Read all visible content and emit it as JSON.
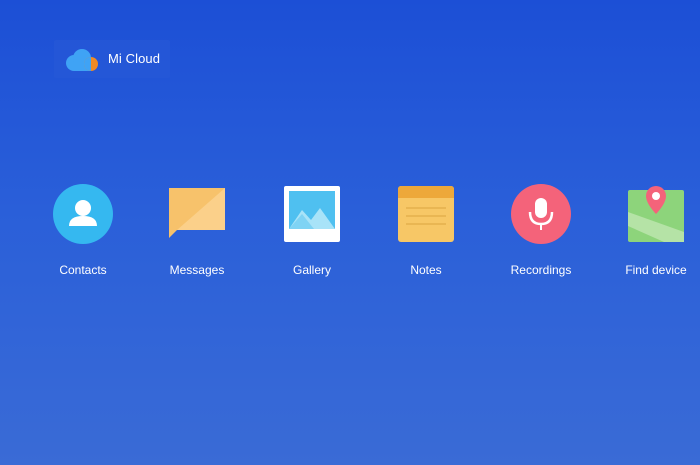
{
  "brand": {
    "name": "Mi Cloud",
    "logo_icon": "cloud-logo-icon",
    "colors": {
      "cloud": "#3fa3f5",
      "dot": "#f08a24"
    }
  },
  "background": {
    "top": "#1c4fd6",
    "bottom": "#3a6bd6"
  },
  "apps": [
    {
      "label": "Contacts",
      "icon": "contacts-icon",
      "color": "#35b8f0"
    },
    {
      "label": "Messages",
      "icon": "messages-icon",
      "color": "#f7c26b"
    },
    {
      "label": "Gallery",
      "icon": "gallery-icon",
      "color": "#4fc0f0"
    },
    {
      "label": "Notes",
      "icon": "notes-icon",
      "color": "#f7c766"
    },
    {
      "label": "Recordings",
      "icon": "recordings-icon",
      "color": "#f4637a"
    },
    {
      "label": "Find device",
      "icon": "find-device-icon",
      "color": "#8dd47b"
    }
  ]
}
